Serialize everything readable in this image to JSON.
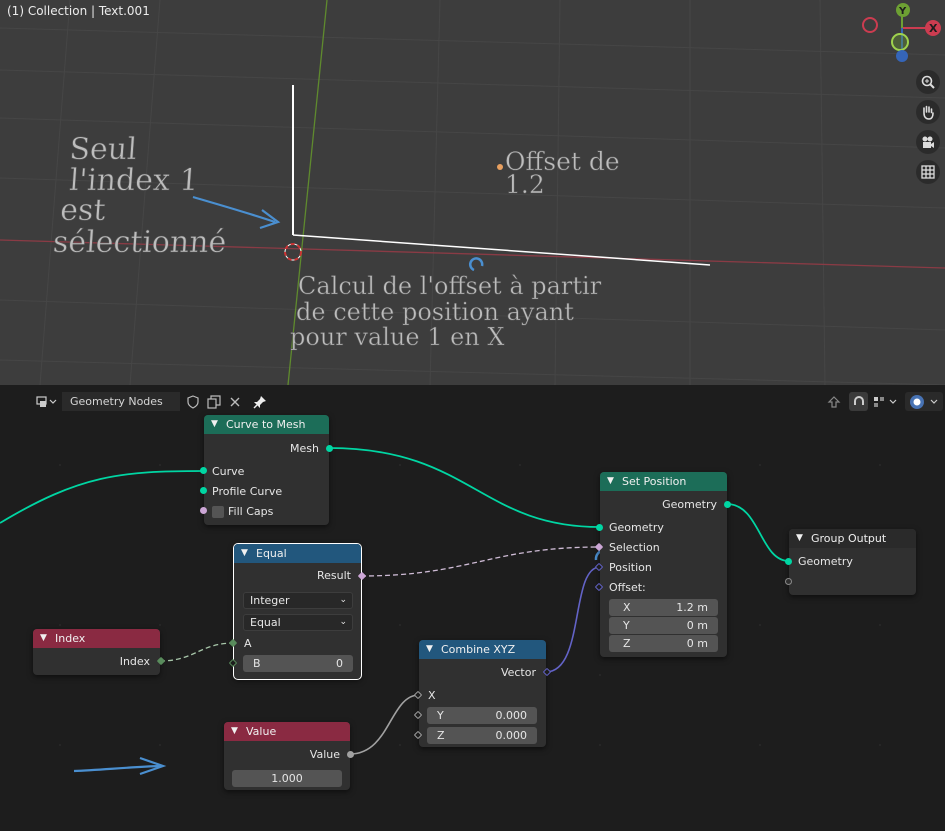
{
  "viewport": {
    "title": "(1) Collection | Text.001",
    "text_left": [
      "Seul",
      "l'index 1",
      "est",
      "sélectionné"
    ],
    "text_top": [
      "Offset de",
      "1.2"
    ],
    "text_bottom": [
      "Calcul de l'offset à partir",
      "de cette position ayant",
      "pour value 1 en X"
    ],
    "gizmo": {
      "x_label": "X",
      "y_label": "Y"
    },
    "tools": [
      "zoom-icon",
      "hand-icon",
      "camera-icon",
      "grid-icon"
    ]
  },
  "editor": {
    "tree_name": "Geometry Nodes",
    "nodes": {
      "curve_to_mesh": {
        "title": "Curve to Mesh",
        "out_mesh": "Mesh",
        "in_curve": "Curve",
        "in_profile": "Profile Curve",
        "fill_caps": "Fill Caps"
      },
      "equal": {
        "title": "Equal",
        "out_result": "Result",
        "data_type": "Integer",
        "operation": "Equal",
        "in_a": "A",
        "in_b_label": "B",
        "in_b_value": "0"
      },
      "index": {
        "title": "Index",
        "out_index": "Index"
      },
      "value": {
        "title": "Value",
        "out_value": "Value",
        "value": "1.000"
      },
      "combine_xyz": {
        "title": "Combine XYZ",
        "out_vector": "Vector",
        "in_x": "X",
        "in_y_label": "Y",
        "in_y_value": "0.000",
        "in_z_label": "Z",
        "in_z_value": "0.000"
      },
      "set_position": {
        "title": "Set Position",
        "out_geometry": "Geometry",
        "in_geometry": "Geometry",
        "in_selection": "Selection",
        "in_position": "Position",
        "in_offset": "Offset:",
        "offset_x_label": "X",
        "offset_x": "1.2 m",
        "offset_y_label": "Y",
        "offset_y": "0 m",
        "offset_z_label": "Z",
        "offset_z": "0 m"
      },
      "group_output": {
        "title": "Group Output",
        "in_geometry": "Geometry"
      }
    }
  },
  "colors": {
    "geometry_socket": "#00d6a3",
    "geometry_header": "#1c6d58",
    "converter_header": "#22577d",
    "input_header": "#8a2a42",
    "vector_socket": "#6363c7",
    "annotation": "#4a8fd0"
  }
}
